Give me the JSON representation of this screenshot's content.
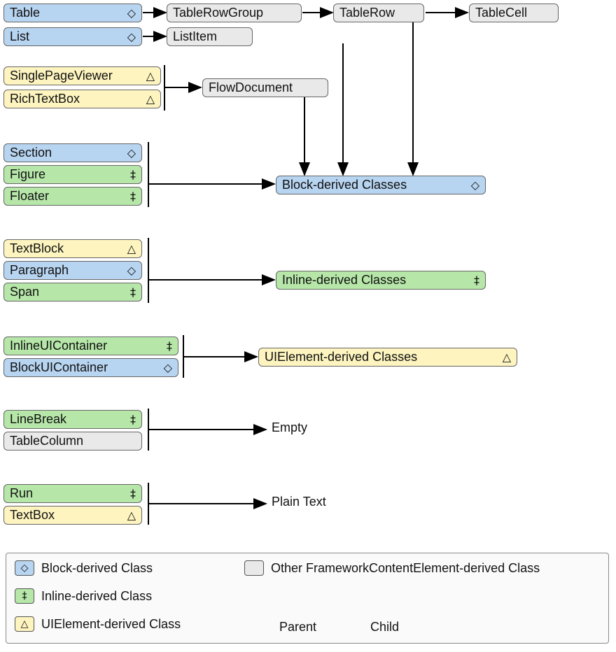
{
  "symbols": {
    "block": "◇",
    "inline": "‡",
    "ui": "△",
    "arrow": "→"
  },
  "nodes": {
    "table": "Table",
    "tablerowgroup": "TableRowGroup",
    "tablerow": "TableRow",
    "tablecell": "TableCell",
    "list": "List",
    "listitem": "ListItem",
    "singlepageviewer": "SinglePageViewer",
    "richtextbox": "RichTextBox",
    "flowdocument": "FlowDocument",
    "section": "Section",
    "figure": "Figure",
    "floater": "Floater",
    "blockderived": "Block-derived Classes",
    "textblock": "TextBlock",
    "paragraph": "Paragraph",
    "span": "Span",
    "inlinederived": "Inline-derived Classes",
    "inlineuicontainer": "InlineUIContainer",
    "blockuicontainer": "BlockUIContainer",
    "uielementderived": "UIElement-derived Classes",
    "linebreak": "LineBreak",
    "tablecolumn": "TableColumn",
    "empty": "Empty",
    "run": "Run",
    "textbox": "TextBox",
    "plaintext": "Plain Text"
  },
  "legend": {
    "block": "Block-derived Class",
    "inline": "Inline-derived Class",
    "ui": "UIElement-derived Class",
    "other": "Other FrameworkContentElement-derived Class",
    "parent": "Parent",
    "child": "Child"
  }
}
